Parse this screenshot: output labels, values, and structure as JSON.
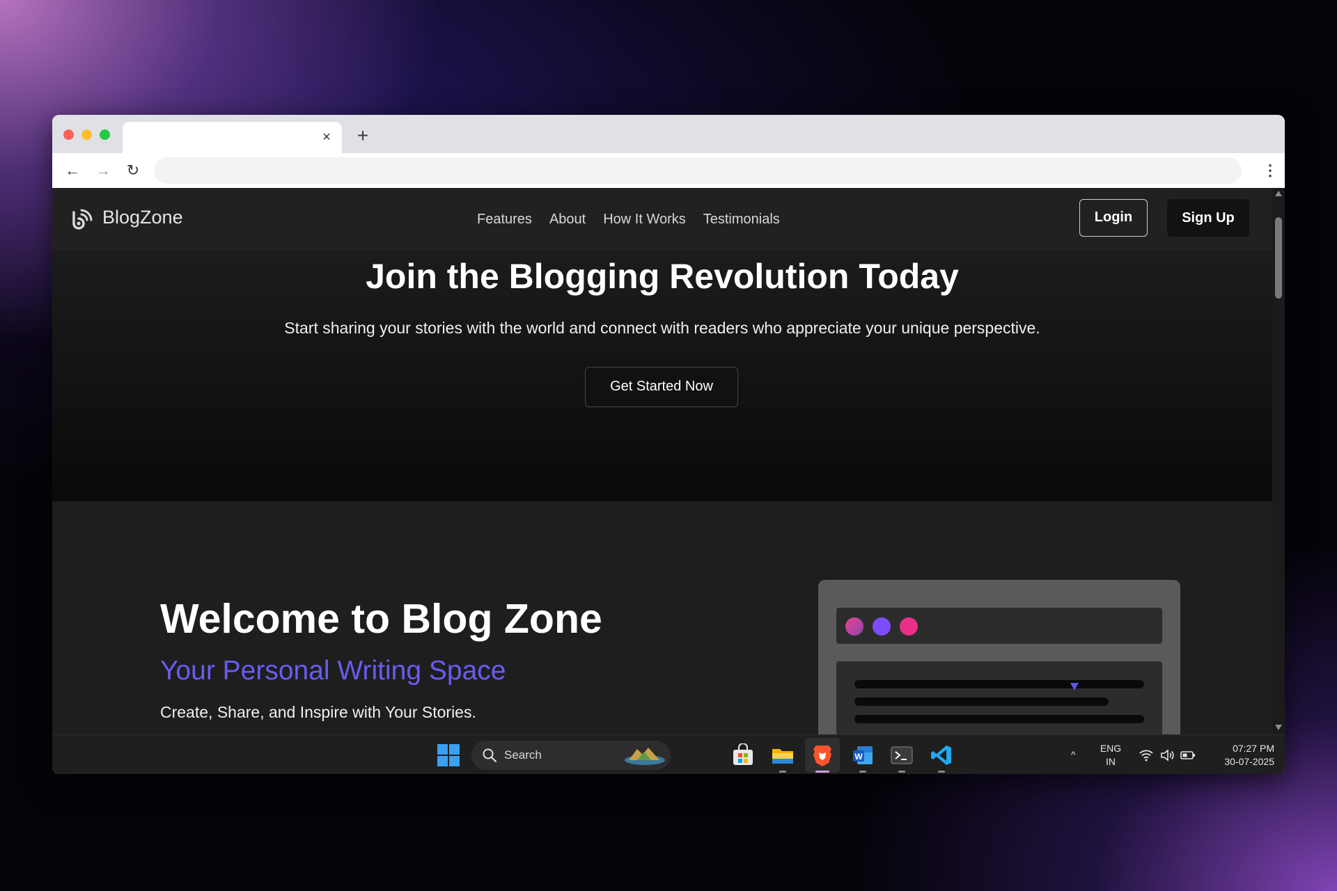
{
  "browser": {
    "tab_title": "",
    "tab_close_glyph": "×",
    "new_tab_glyph": "+",
    "back_glyph": "←",
    "forward_glyph": "→",
    "reload_glyph": "↻",
    "menu_glyph": "⋮",
    "address": ""
  },
  "site": {
    "brand": "BlogZone",
    "nav_links": [
      "Features",
      "About",
      "How It Works",
      "Testimonials"
    ],
    "login_label": "Login",
    "signup_label": "Sign Up"
  },
  "cta": {
    "title": "Join the Blogging Revolution Today",
    "subtitle": "Start sharing your stories with the world and connect with readers who appreciate your unique perspective.",
    "button_label": "Get Started Now"
  },
  "hero": {
    "title": "Welcome to Blog Zone",
    "subtitle": "Your Personal Writing Space",
    "text": "Create, Share, and Inspire with Your Stories."
  },
  "taskbar": {
    "search_label": "Search",
    "apps": [
      "windows-start",
      "search",
      "microsoft-store",
      "file-explorer",
      "brave-browser",
      "microsoft-word",
      "terminal",
      "vs-code"
    ],
    "language_line1": "ENG",
    "language_line2": "IN",
    "time": "07:27 PM",
    "date": "30-07-2025",
    "tray_chevron_glyph": "^"
  },
  "colors": {
    "accent": "#6a5cf2",
    "page_bg": "#141414",
    "nav_bg": "#212121"
  }
}
